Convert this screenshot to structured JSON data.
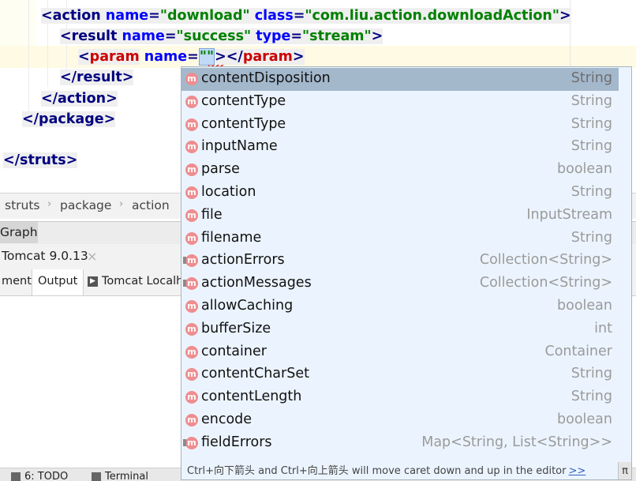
{
  "editor": {
    "lines": [
      {
        "indent_text": "<action name=\"download\" class=\"com.liu.action.downloadAction\">"
      },
      {
        "indent_text": "<result name=\"success\" type=\"stream\">"
      },
      {
        "indent_text": "<param name=\"\"></param>"
      },
      {
        "indent_text": "</result>"
      },
      {
        "indent_text": "</action>"
      },
      {
        "indent_text": "</package>"
      },
      {
        "indent_text": "</struts>"
      }
    ],
    "tokens": {
      "action_open": "<action",
      "attr_name": "name",
      "eq": "=",
      "download_val": "\"download\"",
      "attr_class": "class",
      "class_val": "\"com.liu.action.downloadAction\"",
      "gt": ">",
      "result_open": "<result",
      "success_val": "\"success\"",
      "attr_type": "type",
      "stream_val": "\"stream\"",
      "param_lt": "<",
      "param_tag": "param",
      "param_quote_open": "\"",
      "param_quote_close": "\"",
      "param_close_lt": "</",
      "param_close_tag": "param",
      "result_close": "</result>",
      "action_close": "</action>",
      "package_close": "</package>",
      "struts_close": "</struts>"
    }
  },
  "breadcrumb": [
    "struts",
    "package",
    "action"
  ],
  "panels": {
    "graph_tab": "Graph",
    "run_tab": "Tomcat 9.0.13",
    "close_symbol": "×",
    "subtabs": {
      "deployment": "ment",
      "output": "Output",
      "tomcat_log": "Tomcat Localh"
    },
    "bottom": {
      "todo": "6: TODO",
      "terminal": "Terminal"
    }
  },
  "completion": {
    "icon_letter": "m",
    "items": [
      {
        "name": "contentDisposition",
        "type": "String",
        "selected": true,
        "locked": false
      },
      {
        "name": "contentType",
        "type": "String",
        "selected": false,
        "locked": false
      },
      {
        "name": "contentType",
        "type": "String",
        "selected": false,
        "locked": false
      },
      {
        "name": "inputName",
        "type": "String",
        "selected": false,
        "locked": false
      },
      {
        "name": "parse",
        "type": "boolean",
        "selected": false,
        "locked": false
      },
      {
        "name": "location",
        "type": "String",
        "selected": false,
        "locked": false
      },
      {
        "name": "file",
        "type": "InputStream",
        "selected": false,
        "locked": false
      },
      {
        "name": "filename",
        "type": "String",
        "selected": false,
        "locked": false
      },
      {
        "name": "actionErrors",
        "type": "Collection<String>",
        "selected": false,
        "locked": true
      },
      {
        "name": "actionMessages",
        "type": "Collection<String>",
        "selected": false,
        "locked": true
      },
      {
        "name": "allowCaching",
        "type": "boolean",
        "selected": false,
        "locked": false
      },
      {
        "name": "bufferSize",
        "type": "int",
        "selected": false,
        "locked": false
      },
      {
        "name": "container",
        "type": "Container",
        "selected": false,
        "locked": false
      },
      {
        "name": "contentCharSet",
        "type": "String",
        "selected": false,
        "locked": false
      },
      {
        "name": "contentLength",
        "type": "String",
        "selected": false,
        "locked": false
      },
      {
        "name": "encode",
        "type": "boolean",
        "selected": false,
        "locked": false
      },
      {
        "name": "fieldErrors",
        "type": "Map<String, List<String>>",
        "selected": false,
        "locked": true
      }
    ],
    "footer_text": "Ctrl+向下箭头 and Ctrl+向上箭头 will move caret down and up in the editor",
    "footer_link": ">>",
    "pi_symbol": "π"
  },
  "colors": {
    "tag": "#000080",
    "attribute": "#0000ff",
    "value": "#008000",
    "unknown_tag": "#cc0000",
    "popup_bg": "#ebf4fe",
    "selection": "#a4b8cc",
    "method_icon": "#ef8d8f"
  }
}
